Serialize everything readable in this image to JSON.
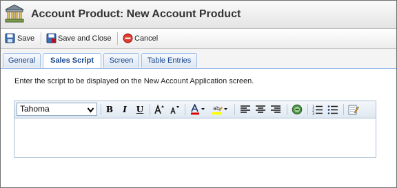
{
  "window": {
    "title": "Account Product: New Account Product",
    "icon": "bank-building-icon"
  },
  "toolbar": {
    "save_label": "Save",
    "save_close_label": "Save and Close",
    "cancel_label": "Cancel"
  },
  "tabs": [
    {
      "label": "General",
      "active": false
    },
    {
      "label": "Sales Script",
      "active": true
    },
    {
      "label": "Screen",
      "active": false
    },
    {
      "label": "Table Entries",
      "active": false
    }
  ],
  "content": {
    "instruction": "Enter the script to be displayed on the New Account Application screen."
  },
  "editor": {
    "font_value": "Tahoma",
    "toolbar_icons": [
      "bold-icon",
      "italic-icon",
      "underline-icon",
      "grow-font-icon",
      "shrink-font-icon",
      "font-color-icon",
      "highlight-color-icon",
      "align-left-icon",
      "align-center-icon",
      "align-right-icon",
      "insert-link-icon",
      "ordered-list-icon",
      "unordered-list-icon",
      "source-edit-icon"
    ],
    "bold_glyph": "B",
    "italic_glyph": "I",
    "underline_glyph": "U",
    "content": ""
  },
  "colors": {
    "tab_text": "#15428b",
    "font_color_bar": "#e00000",
    "highlight_bar": "#ffff00"
  }
}
